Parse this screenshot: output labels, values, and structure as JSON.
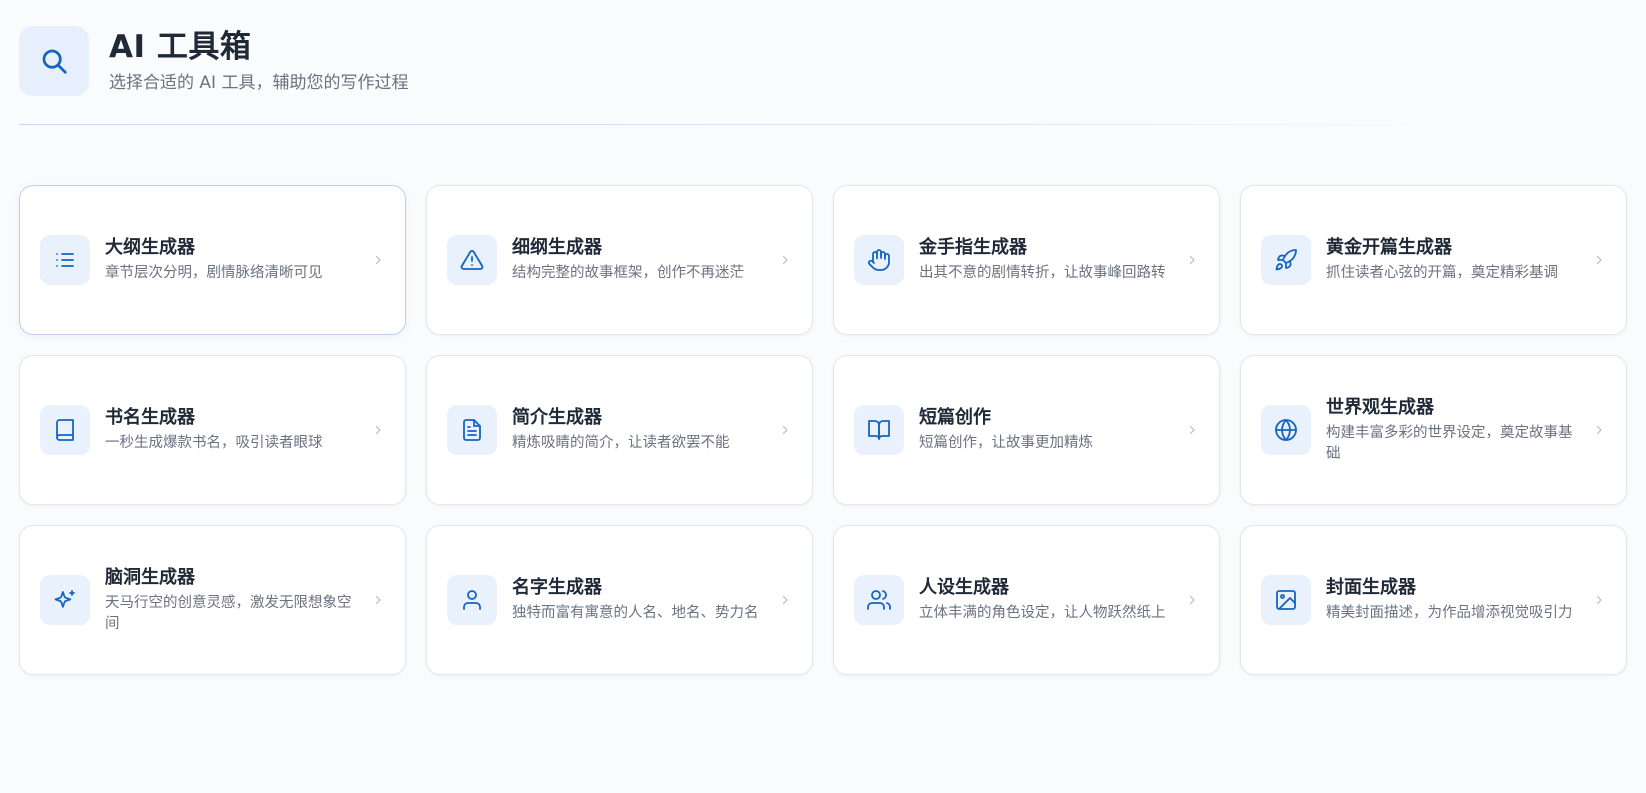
{
  "header": {
    "icon": "search-icon",
    "title": "AI 工具箱",
    "subtitle": "选择合适的 AI 工具，辅助您的写作过程"
  },
  "colors": {
    "accent": "#1565c0",
    "icon_bg": "#e8f1fc",
    "active_border": "#b9cff0"
  },
  "tools": [
    {
      "title": "大纲生成器",
      "desc": "章节层次分明，剧情脉络清晰可见",
      "icon": "list-icon",
      "active": true
    },
    {
      "title": "细纲生成器",
      "desc": "结构完整的故事框架，创作不再迷茫",
      "icon": "alert-triangle-icon"
    },
    {
      "title": "金手指生成器",
      "desc": "出其不意的剧情转折，让故事峰回路转",
      "icon": "hand-icon"
    },
    {
      "title": "黄金开篇生成器",
      "desc": "抓住读者心弦的开篇，奠定精彩基调",
      "icon": "rocket-icon"
    },
    {
      "title": "书名生成器",
      "desc": "一秒生成爆款书名，吸引读者眼球",
      "icon": "book-icon"
    },
    {
      "title": "简介生成器",
      "desc": "精炼吸睛的简介，让读者欲罢不能",
      "icon": "file-text-icon"
    },
    {
      "title": "短篇创作",
      "desc": "短篇创作，让故事更加精炼",
      "icon": "book-open-icon"
    },
    {
      "title": "世界观生成器",
      "desc": "构建丰富多彩的世界设定，奠定故事基础",
      "icon": "globe-icon"
    },
    {
      "title": "脑洞生成器",
      "desc": "天马行空的创意灵感，激发无限想象空间",
      "icon": "sparkles-icon"
    },
    {
      "title": "名字生成器",
      "desc": "独特而富有寓意的人名、地名、势力名",
      "icon": "user-icon"
    },
    {
      "title": "人设生成器",
      "desc": "立体丰满的角色设定，让人物跃然纸上",
      "icon": "users-icon"
    },
    {
      "title": "封面生成器",
      "desc": "精美封面描述，为作品增添视觉吸引力",
      "icon": "image-icon"
    }
  ]
}
